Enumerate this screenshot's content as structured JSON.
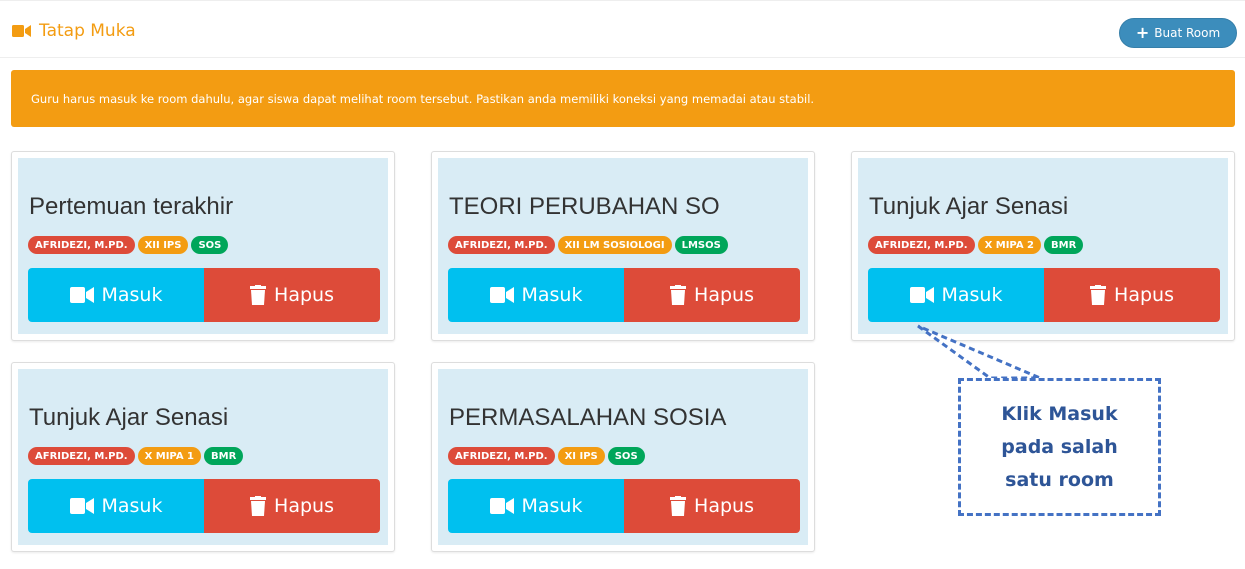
{
  "header": {
    "title": "Tatap Muka",
    "title_icon": "video-camera-icon",
    "buat_room_label": "Buat Room",
    "accent_color": "#f39c12"
  },
  "alert": {
    "text": "Guru harus masuk ke room dahulu, agar siswa dapat melihat room tersebut. Pastikan anda memiliki koneksi yang memadai atau stabil."
  },
  "rooms": [
    {
      "title": "Pertemuan terakhir",
      "tags": [
        "AFRIDEZI, M.PD.",
        "XII IPS",
        "SOS"
      ],
      "masuk_label": "Masuk",
      "hapus_label": "Hapus"
    },
    {
      "title": "TEORI PERUBAHAN SO",
      "tags": [
        "AFRIDEZI, M.PD.",
        "XII LM SOSIOLOGI",
        "LMSOS"
      ],
      "masuk_label": "Masuk",
      "hapus_label": "Hapus"
    },
    {
      "title": "Tunjuk Ajar Senasi",
      "tags": [
        "AFRIDEZI, M.PD.",
        "X MIPA 2",
        "BMR"
      ],
      "masuk_label": "Masuk",
      "hapus_label": "Hapus"
    },
    {
      "title": "Tunjuk Ajar Senasi",
      "tags": [
        "AFRIDEZI, M.PD.",
        "X MIPA 1",
        "BMR"
      ],
      "masuk_label": "Masuk",
      "hapus_label": "Hapus"
    },
    {
      "title": "PERMASALAHAN SOSIA",
      "tags": [
        "AFRIDEZI, M.PD.",
        "XI IPS",
        "SOS"
      ],
      "masuk_label": "Masuk",
      "hapus_label": "Hapus"
    }
  ],
  "callout": {
    "lines": [
      "Klik Masuk",
      "pada salah",
      "satu room"
    ],
    "color": "#4472c4"
  },
  "colors": {
    "masuk": "#00c0ef",
    "hapus": "#dd4b39",
    "tag_teacher": "#dd4b39",
    "tag_class": "#f39c12",
    "tag_subject": "#00a65a",
    "card_bg": "#d9ecf5"
  }
}
